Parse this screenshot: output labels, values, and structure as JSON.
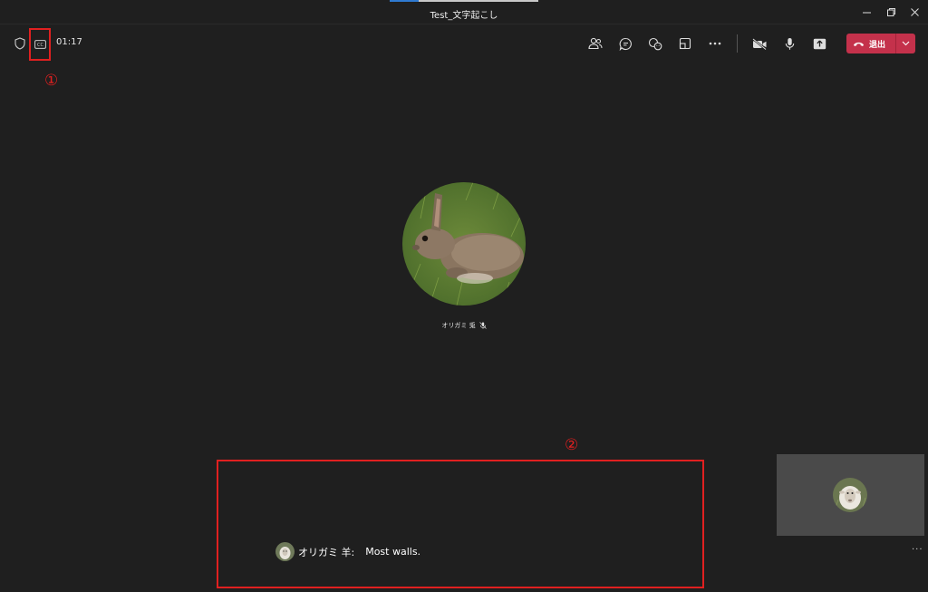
{
  "window": {
    "title": "Test_文字起こし"
  },
  "meeting_bar": {
    "timer": "01:17",
    "controls": [
      "people-icon",
      "chat-icon",
      "reactions-icon",
      "rooms-icon",
      "more-icon",
      "camera-off-icon",
      "mic-icon",
      "share-icon"
    ],
    "leave_label": "退出",
    "leave_color": "#c4314b"
  },
  "annotations": {
    "marker_1": "①",
    "marker_2": "②",
    "highlight_color": "#e02020"
  },
  "participant": {
    "name": "オリガミ 兎"
  },
  "caption": {
    "speaker": "オリガミ 羊:",
    "text": "Most walls."
  },
  "self_tile": {
    "more": "..."
  }
}
